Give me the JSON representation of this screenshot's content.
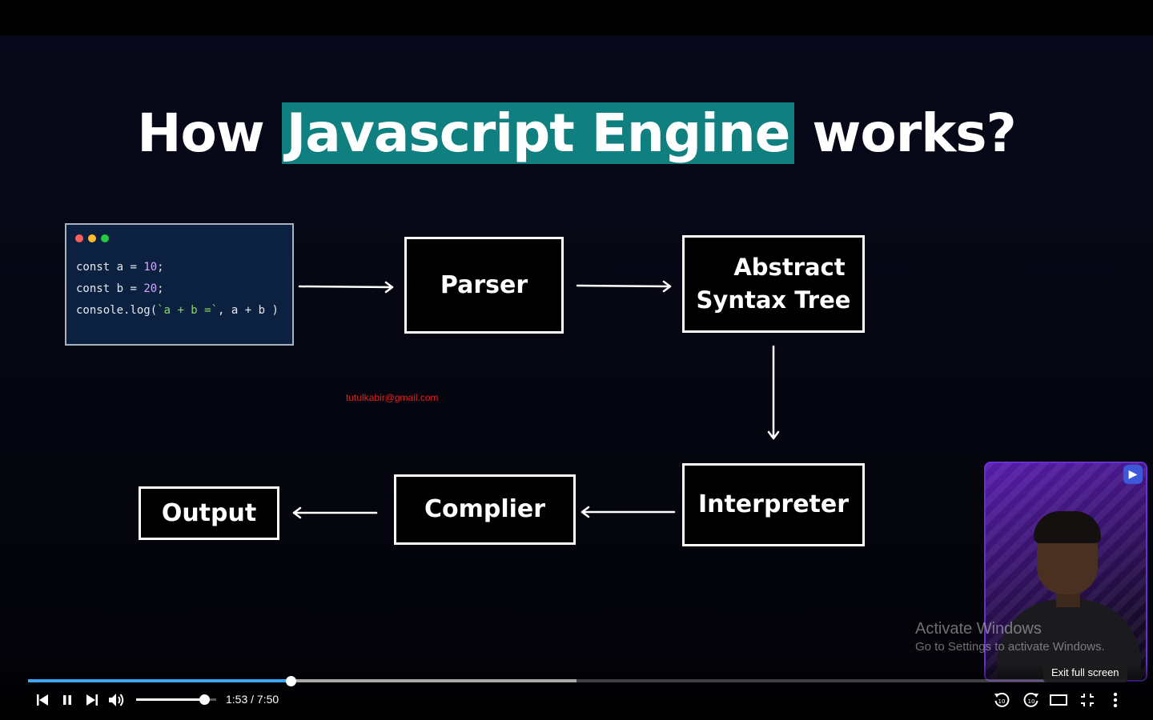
{
  "slide": {
    "title_before": "How ",
    "title_highlight": "Javascript Engine",
    "title_after": " works?",
    "code_lines": [
      {
        "kw": "const",
        "name": " a = ",
        "num": "10",
        "end": ";"
      },
      {
        "kw": "const",
        "name": " b = ",
        "num": "20",
        "end": ";"
      },
      {
        "pre": "console.log(",
        "str": "`a + b =`",
        "post": ", a + b )"
      }
    ],
    "boxes": {
      "parser": "Parser",
      "ast_line1": "Abstract",
      "ast_line2": "Syntax Tree",
      "interpreter": "Interpreter",
      "compiler": "Complier",
      "output": "Output"
    },
    "watermark": "tutulkabir@gmail.com"
  },
  "overlay": {
    "activate_title": "Activate Windows",
    "activate_sub": "Go to Settings to activate Windows."
  },
  "player": {
    "time": "1:53 / 7:50",
    "played_fraction": 0.24,
    "buffered_fraction": 0.5,
    "volume_fraction": 0.85,
    "tooltip": "Exit full screen",
    "accent_color": "#3ea6ff"
  },
  "icons": [
    "previous-icon",
    "pause-icon",
    "next-icon",
    "volume-icon",
    "rewind-10-icon",
    "forward-10-icon",
    "theater-mode-icon",
    "exit-fullscreen-icon",
    "more-icon"
  ]
}
